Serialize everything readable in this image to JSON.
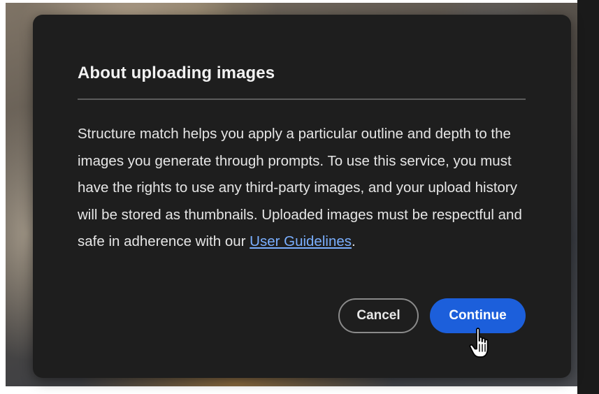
{
  "dialog": {
    "title": "About uploading images",
    "body_text": "Structure match helps you apply a particular outline and depth to the images you generate through prompts. To use this service, you must have the rights to use any third-party images, and your upload history will be stored as thumbnails. Uploaded images must be respectful and safe in adherence with our ",
    "link_text": "User Guidelines",
    "body_end": ".",
    "cancel_label": "Cancel",
    "continue_label": "Continue"
  },
  "colors": {
    "dialog_bg": "#1e1e1e",
    "link": "#7aafff",
    "primary_button": "#1c5fdb"
  },
  "icons": {
    "pointer": "hand-pointer-icon"
  }
}
